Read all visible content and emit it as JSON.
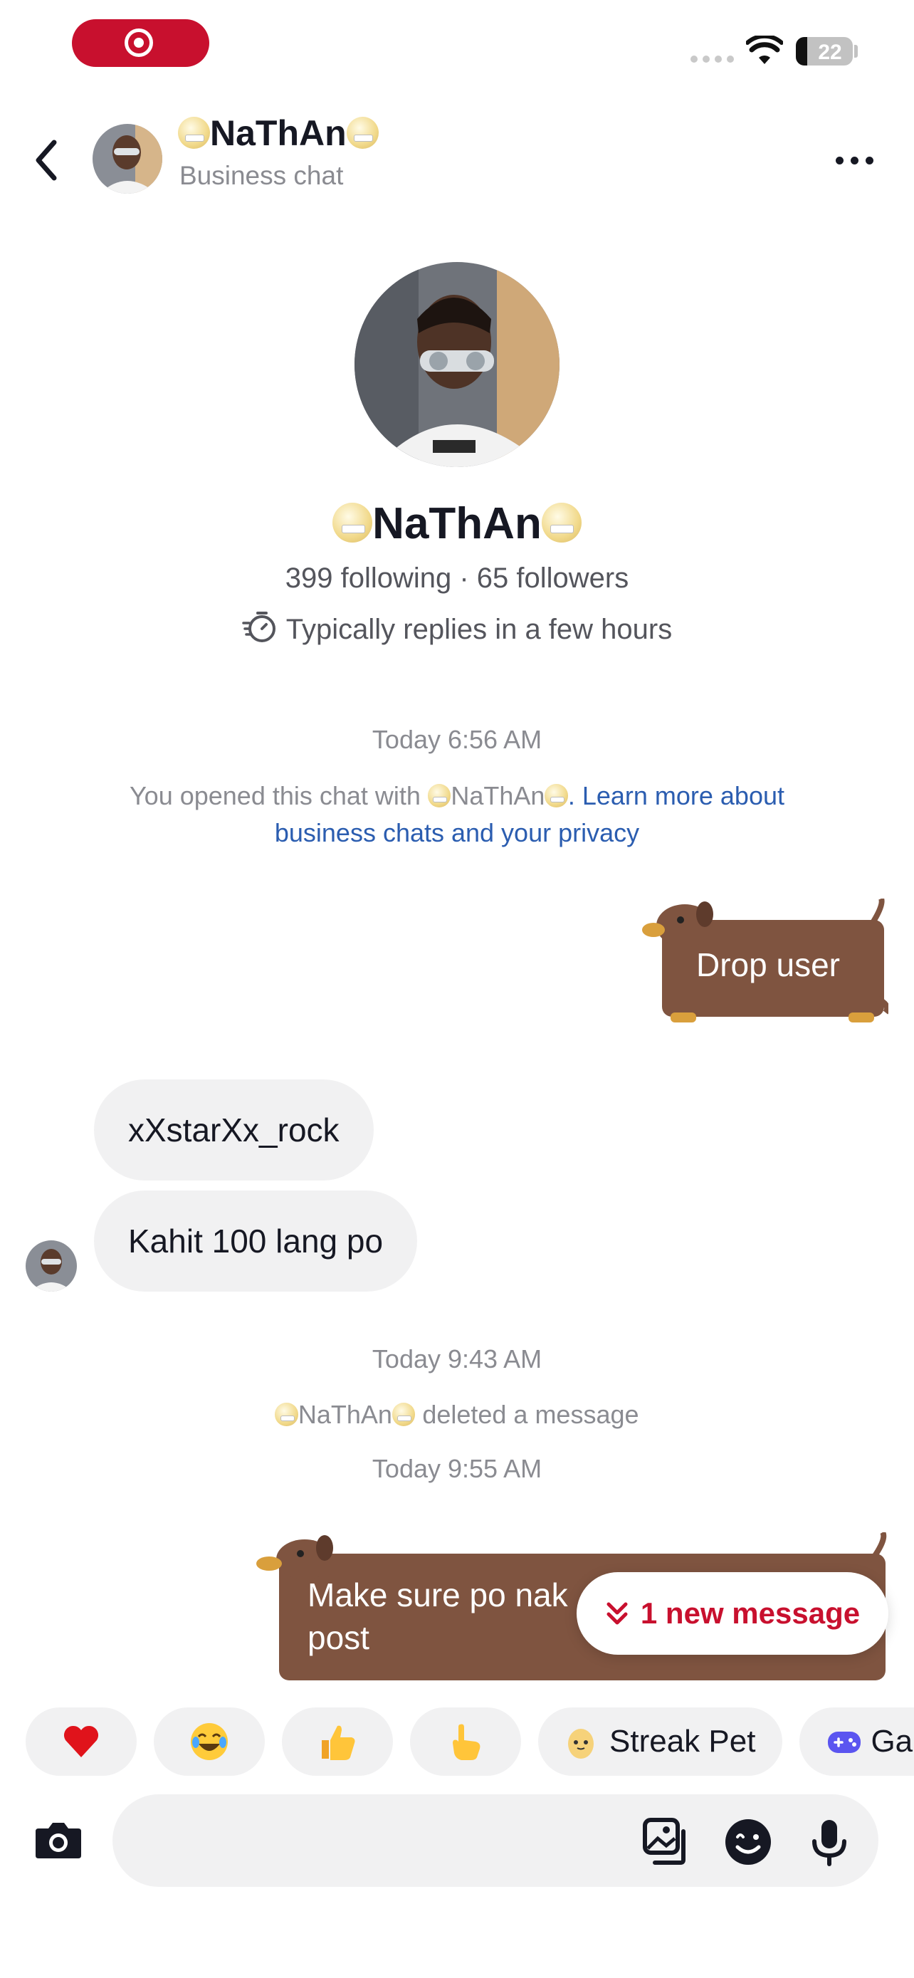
{
  "status_bar": {
    "battery": "22"
  },
  "header": {
    "name": "NaThAn",
    "subtitle": "Business chat"
  },
  "profile": {
    "name": "NaThAn",
    "stats": "399 following · 65 followers",
    "replies": "Typically replies in a few hours"
  },
  "messages": {
    "time1": "Today 6:56 AM",
    "notice_prefix": "You opened this chat with ",
    "notice_name": "NaThAn",
    "notice_link": ". Learn more about business chats and your privacy",
    "sent1": "Drop user",
    "recv1": "xXstarXx_rock",
    "recv2": "Kahit 100 lang po",
    "time2": "Today 9:43 AM",
    "deleted_name": "NaThAn",
    "deleted_text": " deleted a message",
    "time3": "Today 9:55 AM",
    "sent2": "Make sure po nak",
    "sent2_line2": "post"
  },
  "new_message_pill": "1 new message",
  "quick_reactions": {
    "streak_pet": "Streak Pet",
    "games": "Ga"
  },
  "colors": {
    "accent": "#c8102e",
    "sticker_brown": "#7f5440",
    "bubble_gray": "#f1f1f2",
    "link_blue": "#2b5db0"
  }
}
